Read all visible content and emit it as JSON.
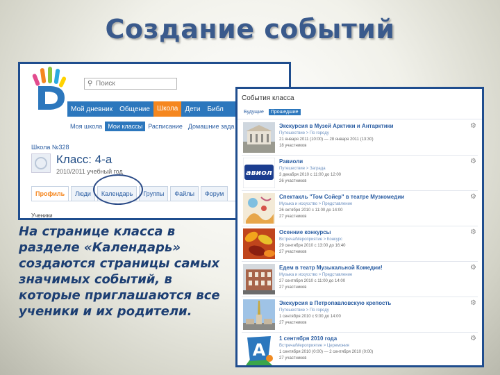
{
  "slide": {
    "title": "Создание событий"
  },
  "left_screenshot": {
    "search_placeholder": "Поиск",
    "main_nav": [
      "Мой дневник",
      "Общение",
      "Школа",
      "Дети",
      "Библ"
    ],
    "main_nav_active": "Школа",
    "sub_nav": [
      "Моя школа",
      "Мои классы",
      "Расписание",
      "Домашние зада"
    ],
    "sub_nav_active": "Мои классы",
    "school": "Школа №328",
    "class_name": "Класс: 4-а",
    "year": "2010/2011 учебный год",
    "tabs": [
      "Профиль",
      "Люди",
      "Календарь",
      "Группы",
      "Файлы",
      "Форум"
    ],
    "tab_active": "Профиль",
    "students_label": "Ученики"
  },
  "caption": "На странице класса в разделе «Календарь» создаются страницы самых значимых событий, в которые приглашаются все ученики и их родители.",
  "right_screenshot": {
    "title": "События класса",
    "tabs": [
      "Будущие",
      "Прошедшие"
    ],
    "tab_active": "Прошедшие",
    "events": [
      {
        "name": "Экскурсия в Музей Арктики и Антарктики",
        "category": "Путешествие > По городу",
        "date": "21 января 2011 (10:00) — 28 января 2011 (13:30)",
        "count": "18 участников",
        "thumb": "museum-photo"
      },
      {
        "name": "Равиоли",
        "category": "Путешествие > Заграда",
        "date": "3 декабря 2010 с 11:00 до 12:00",
        "count": "26 участников",
        "thumb": "ravioli-logo",
        "thumb_text": "авиол"
      },
      {
        "name": "Спектакль \"Том Сойер\" в театре Музкомедии",
        "category": "Музыка и искусство > Представление",
        "date": "26 октября 2010 с 11:00 до 14:00",
        "count": "27 участников",
        "thumb": "drawing"
      },
      {
        "name": "Осенние конкурсы",
        "category": "Встреча/Мероприятие > Конкурс",
        "date": "29 сентября 2010 с 13:00 до 16:40",
        "count": "27 участников",
        "thumb": "autumn-leaves"
      },
      {
        "name": "Едем в театр Музыкальной Комедии!",
        "category": "Музыка и искусство > Представление",
        "date": "27 сентября 2010 с 11:00 до 14:00",
        "count": "27 участников",
        "thumb": "theatre-photo"
      },
      {
        "name": "Экскурсия в Петропавловскую крепость",
        "category": "Путешествие > По городу",
        "date": "1 сентября 2010 с 9:00 до 14:00",
        "count": "27 участников",
        "thumb": "fortress-photo"
      },
      {
        "name": "1 сентября 2010 года",
        "category": "Встреча/Мероприятие > Церемония",
        "date": "1 сентября 2010 (0:00) — 2 сентября 2010 (0:00)",
        "count": "27 участников",
        "thumb": "letter-a",
        "thumb_text": "A"
      }
    ]
  },
  "colors": {
    "title": "#3a5a8c",
    "nav_blue": "#2c77bd",
    "nav_active": "#f5871f",
    "frame": "#1f4d8e",
    "caption": "#1d3f73"
  }
}
